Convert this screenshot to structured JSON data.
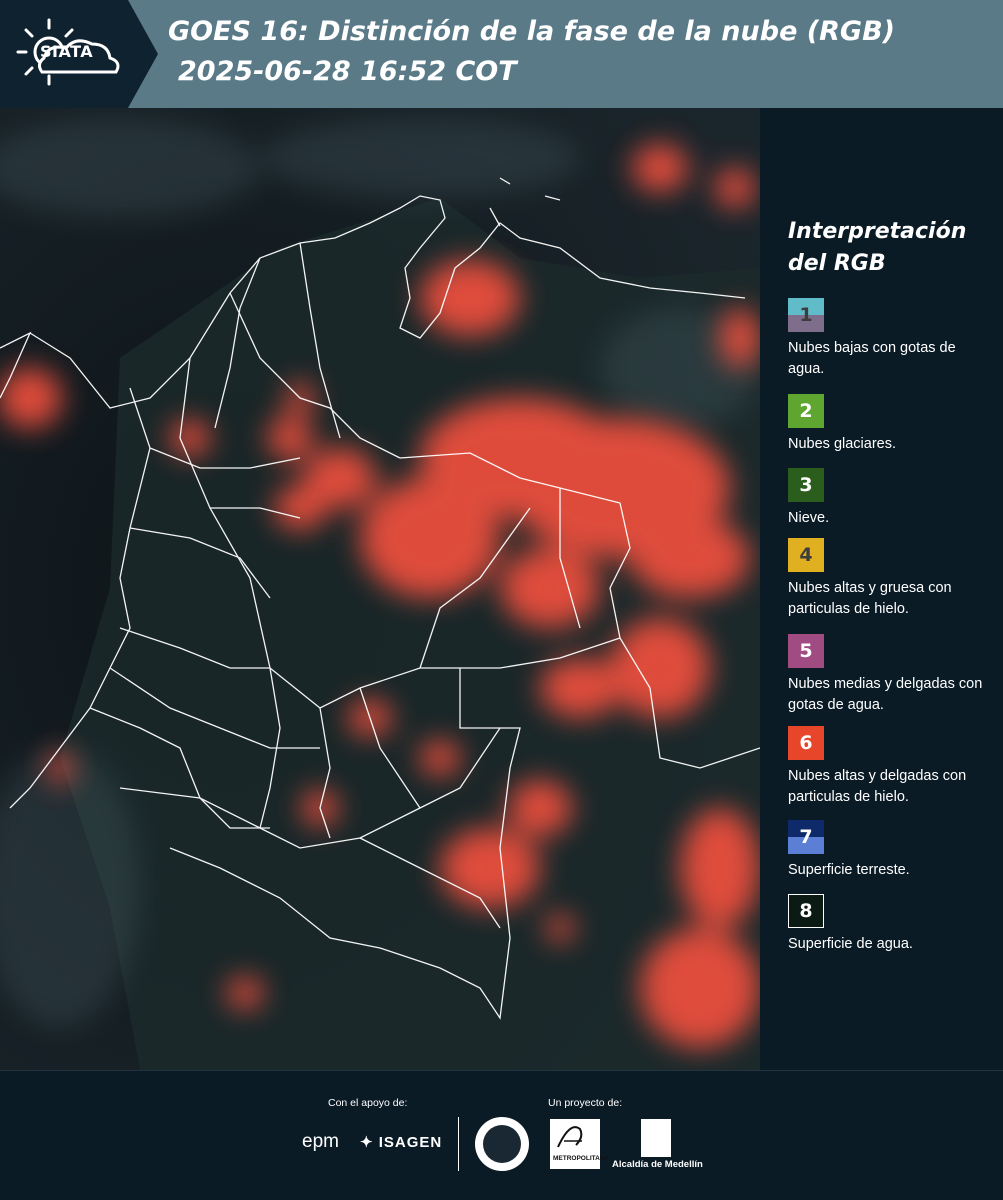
{
  "header": {
    "logo_text": "SIATA",
    "title": "GOES 16: Distinción de la fase de la nube (RGB)",
    "subtitle": "2025-06-28 16:52 COT",
    "bar_color": "#5a7a88",
    "logo_bg_color": "#0f2230"
  },
  "legend": {
    "title_line1": "Interpretación",
    "title_line2": "del RGB",
    "items": [
      {
        "number": "1",
        "label": "Nubes bajas con gotas de agua.",
        "color_top": "#5fbcc8",
        "color_bottom": "#7e6e8c",
        "number_color": "#3d3d3d"
      },
      {
        "number": "2",
        "label": "Nubes glaciares.",
        "color_top": "#5fa631",
        "color_bottom": "#5fa631",
        "number_color": "#ffffff"
      },
      {
        "number": "3",
        "label": "Nieve.",
        "color_top": "#2b5e1c",
        "color_bottom": "#2b5e1c",
        "number_color": "#ffffff"
      },
      {
        "number": "4",
        "label": "Nubes altas y gruesa con particulas de hielo.",
        "color_top": "#e0b021",
        "color_bottom": "#e0b021",
        "number_color": "#3d3d3d"
      },
      {
        "number": "5",
        "label": "Nubes medias y delgadas con gotas de agua.",
        "color_top": "#a04c83",
        "color_bottom": "#a04c83",
        "number_color": "#ffffff"
      },
      {
        "number": "6",
        "label": "Nubes altas y delgadas con particulas de hielo.",
        "color_top": "#e8462a",
        "color_bottom": "#e8462a",
        "number_color": "#ffffff"
      },
      {
        "number": "7",
        "label": "Superficie terreste.",
        "color_top": "#0f2a6a",
        "color_bottom": "#5a7fd4",
        "number_color": "#ffffff"
      },
      {
        "number": "8",
        "label": "Superficie de agua.",
        "color_top": "#0b1a12",
        "color_bottom": "#0b1a12",
        "number_color": "#ffffff"
      }
    ]
  },
  "footer": {
    "support_label": "Con el apoyo de:",
    "project_label": "Un proyecto de:",
    "epm": "epm",
    "isagen": "ISAGEN",
    "amva_text": "METROPOLITANA",
    "alcaldia": "Alcaldía de Medellín"
  },
  "map": {
    "cloud_color": "#f0503c",
    "background_color": "#141e24",
    "border_color": "#ffffff"
  }
}
